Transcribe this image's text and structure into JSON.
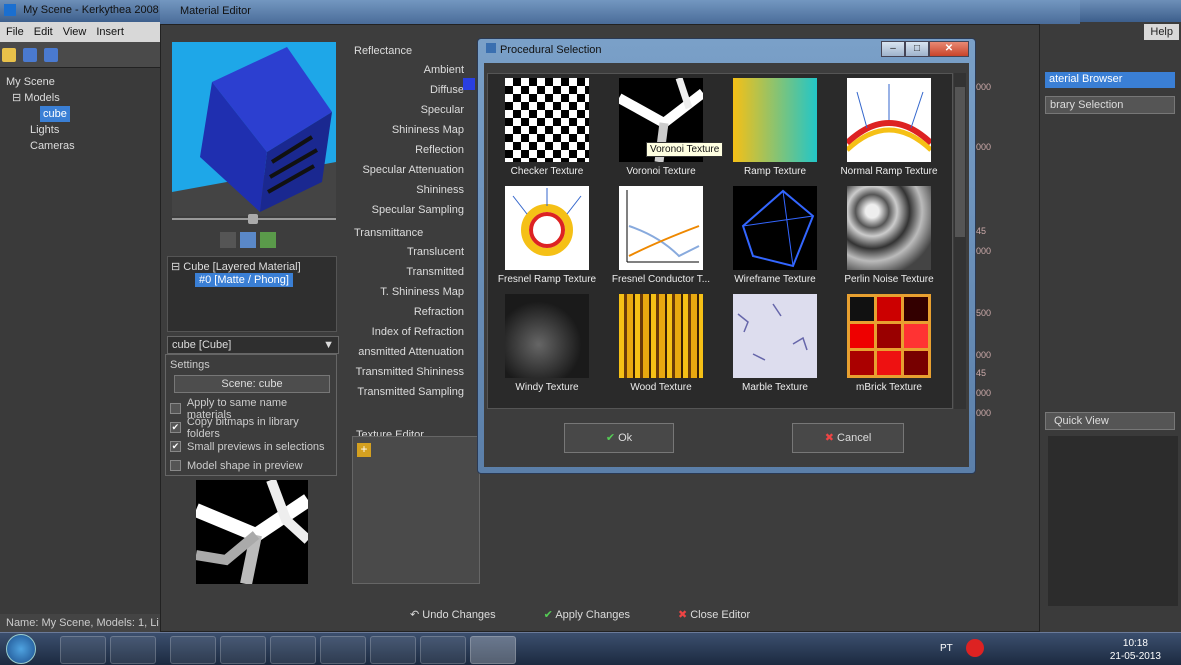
{
  "main_window": {
    "title": "My Scene - Kerkythea 2008",
    "menu": [
      "File",
      "Edit",
      "View",
      "Insert",
      "S"
    ],
    "help": "Help",
    "tree": {
      "root": "My Scene",
      "models": "Models",
      "selected": "cube",
      "lights": "Lights",
      "cameras": "Cameras"
    },
    "status": "Name: My Scene, Models: 1, Li"
  },
  "right_panel": {
    "browser_title": "aterial Browser",
    "library_selection": "brary Selection",
    "quick_view": "Quick View"
  },
  "editor": {
    "title": "Material Editor",
    "material_tree": {
      "root": "Cube [Layered Material]",
      "layer": "#0 [Matte / Phong]"
    },
    "object_select": "cube [Cube]",
    "settings": {
      "label": "Settings",
      "scene_button": "Scene: cube",
      "options": [
        {
          "label": "Apply to same name materials",
          "checked": false
        },
        {
          "label": "Copy bitmaps in library folders",
          "checked": true
        },
        {
          "label": "Small previews in selections",
          "checked": true
        },
        {
          "label": "Model shape in preview",
          "checked": false
        }
      ]
    },
    "reflectance": {
      "label": "Reflectance",
      "rows": [
        "Ambient",
        "Diffuse",
        "Specular",
        "Shininess Map",
        "Reflection",
        "Specular Attenuation",
        "Shininess",
        "Specular Sampling"
      ]
    },
    "transmittance": {
      "label": "Transmittance",
      "rows": [
        "Translucent",
        "Transmitted",
        "T. Shininess Map",
        "Refraction",
        "Index of Refraction",
        "ansmitted Attenuation",
        "Transmitted Shininess",
        "Transmitted Sampling"
      ]
    },
    "texture_editor": "Texture Editor",
    "bottom": {
      "undo": "Undo Changes",
      "apply": "Apply Changes",
      "close": "Close Editor"
    },
    "right_values": [
      "000",
      "000",
      "45",
      "000",
      "500",
      "000",
      "45",
      "000",
      "000"
    ]
  },
  "dialog": {
    "title": "Procedural Selection",
    "tooltip": "Voronoi Texture",
    "ok": "Ok",
    "cancel": "Cancel",
    "textures": [
      "Checker Texture",
      "Voronoi Texture",
      "Ramp Texture",
      "Normal Ramp Texture",
      "Fresnel Ramp Texture",
      "Fresnel Conductor T...",
      "Wireframe Texture",
      "Perlin Noise Texture",
      "Windy Texture",
      "Wood Texture",
      "Marble Texture",
      "mBrick Texture"
    ]
  },
  "taskbar": {
    "lang": "PT",
    "time": "10:18",
    "date": "21-05-2013"
  },
  "colors": {
    "accent": "#3a7fd5",
    "preview_bg": "#1ea7e8",
    "cube": "#1f2fb0"
  }
}
